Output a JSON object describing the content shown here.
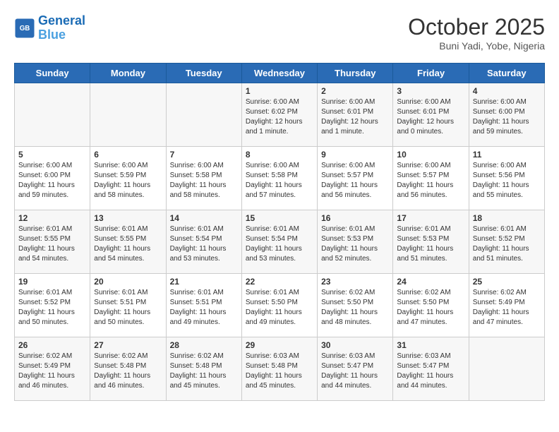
{
  "header": {
    "logo_line1": "General",
    "logo_line2": "Blue",
    "month": "October 2025",
    "location": "Buni Yadi, Yobe, Nigeria"
  },
  "days_of_week": [
    "Sunday",
    "Monday",
    "Tuesday",
    "Wednesday",
    "Thursday",
    "Friday",
    "Saturday"
  ],
  "weeks": [
    [
      {
        "day": "",
        "info": ""
      },
      {
        "day": "",
        "info": ""
      },
      {
        "day": "",
        "info": ""
      },
      {
        "day": "1",
        "info": "Sunrise: 6:00 AM\nSunset: 6:02 PM\nDaylight: 12 hours\nand 1 minute."
      },
      {
        "day": "2",
        "info": "Sunrise: 6:00 AM\nSunset: 6:01 PM\nDaylight: 12 hours\nand 1 minute."
      },
      {
        "day": "3",
        "info": "Sunrise: 6:00 AM\nSunset: 6:01 PM\nDaylight: 12 hours\nand 0 minutes."
      },
      {
        "day": "4",
        "info": "Sunrise: 6:00 AM\nSunset: 6:00 PM\nDaylight: 11 hours\nand 59 minutes."
      }
    ],
    [
      {
        "day": "5",
        "info": "Sunrise: 6:00 AM\nSunset: 6:00 PM\nDaylight: 11 hours\nand 59 minutes."
      },
      {
        "day": "6",
        "info": "Sunrise: 6:00 AM\nSunset: 5:59 PM\nDaylight: 11 hours\nand 58 minutes."
      },
      {
        "day": "7",
        "info": "Sunrise: 6:00 AM\nSunset: 5:58 PM\nDaylight: 11 hours\nand 58 minutes."
      },
      {
        "day": "8",
        "info": "Sunrise: 6:00 AM\nSunset: 5:58 PM\nDaylight: 11 hours\nand 57 minutes."
      },
      {
        "day": "9",
        "info": "Sunrise: 6:00 AM\nSunset: 5:57 PM\nDaylight: 11 hours\nand 56 minutes."
      },
      {
        "day": "10",
        "info": "Sunrise: 6:00 AM\nSunset: 5:57 PM\nDaylight: 11 hours\nand 56 minutes."
      },
      {
        "day": "11",
        "info": "Sunrise: 6:00 AM\nSunset: 5:56 PM\nDaylight: 11 hours\nand 55 minutes."
      }
    ],
    [
      {
        "day": "12",
        "info": "Sunrise: 6:01 AM\nSunset: 5:55 PM\nDaylight: 11 hours\nand 54 minutes."
      },
      {
        "day": "13",
        "info": "Sunrise: 6:01 AM\nSunset: 5:55 PM\nDaylight: 11 hours\nand 54 minutes."
      },
      {
        "day": "14",
        "info": "Sunrise: 6:01 AM\nSunset: 5:54 PM\nDaylight: 11 hours\nand 53 minutes."
      },
      {
        "day": "15",
        "info": "Sunrise: 6:01 AM\nSunset: 5:54 PM\nDaylight: 11 hours\nand 53 minutes."
      },
      {
        "day": "16",
        "info": "Sunrise: 6:01 AM\nSunset: 5:53 PM\nDaylight: 11 hours\nand 52 minutes."
      },
      {
        "day": "17",
        "info": "Sunrise: 6:01 AM\nSunset: 5:53 PM\nDaylight: 11 hours\nand 51 minutes."
      },
      {
        "day": "18",
        "info": "Sunrise: 6:01 AM\nSunset: 5:52 PM\nDaylight: 11 hours\nand 51 minutes."
      }
    ],
    [
      {
        "day": "19",
        "info": "Sunrise: 6:01 AM\nSunset: 5:52 PM\nDaylight: 11 hours\nand 50 minutes."
      },
      {
        "day": "20",
        "info": "Sunrise: 6:01 AM\nSunset: 5:51 PM\nDaylight: 11 hours\nand 50 minutes."
      },
      {
        "day": "21",
        "info": "Sunrise: 6:01 AM\nSunset: 5:51 PM\nDaylight: 11 hours\nand 49 minutes."
      },
      {
        "day": "22",
        "info": "Sunrise: 6:01 AM\nSunset: 5:50 PM\nDaylight: 11 hours\nand 49 minutes."
      },
      {
        "day": "23",
        "info": "Sunrise: 6:02 AM\nSunset: 5:50 PM\nDaylight: 11 hours\nand 48 minutes."
      },
      {
        "day": "24",
        "info": "Sunrise: 6:02 AM\nSunset: 5:50 PM\nDaylight: 11 hours\nand 47 minutes."
      },
      {
        "day": "25",
        "info": "Sunrise: 6:02 AM\nSunset: 5:49 PM\nDaylight: 11 hours\nand 47 minutes."
      }
    ],
    [
      {
        "day": "26",
        "info": "Sunrise: 6:02 AM\nSunset: 5:49 PM\nDaylight: 11 hours\nand 46 minutes."
      },
      {
        "day": "27",
        "info": "Sunrise: 6:02 AM\nSunset: 5:48 PM\nDaylight: 11 hours\nand 46 minutes."
      },
      {
        "day": "28",
        "info": "Sunrise: 6:02 AM\nSunset: 5:48 PM\nDaylight: 11 hours\nand 45 minutes."
      },
      {
        "day": "29",
        "info": "Sunrise: 6:03 AM\nSunset: 5:48 PM\nDaylight: 11 hours\nand 45 minutes."
      },
      {
        "day": "30",
        "info": "Sunrise: 6:03 AM\nSunset: 5:47 PM\nDaylight: 11 hours\nand 44 minutes."
      },
      {
        "day": "31",
        "info": "Sunrise: 6:03 AM\nSunset: 5:47 PM\nDaylight: 11 hours\nand 44 minutes."
      },
      {
        "day": "",
        "info": ""
      }
    ]
  ]
}
